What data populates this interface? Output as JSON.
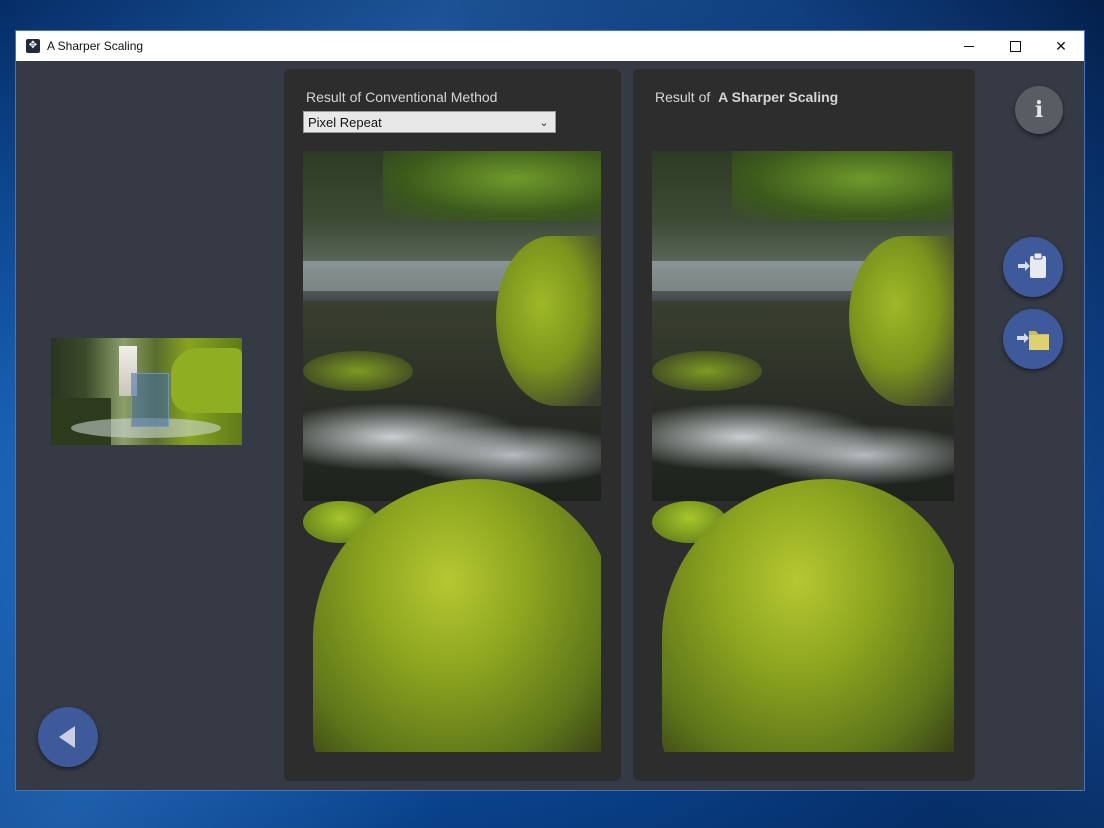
{
  "window": {
    "title": "A Sharper Scaling",
    "app_icon": "app-logo-icon",
    "controls": {
      "minimize": "minimize-icon",
      "maximize": "maximize-icon",
      "close": "close-icon",
      "close_glyph": "✕"
    }
  },
  "left_panel": {
    "title": "Result of Conventional Method",
    "select": {
      "value": "Pixel Repeat",
      "icon": "chevron-down-icon",
      "glyph": "⌄"
    }
  },
  "right_panel": {
    "title_prefix": "Result of",
    "title_brand": "A Sharper Scaling"
  },
  "buttons": {
    "info": {
      "icon": "info-icon",
      "glyph": "i"
    },
    "paste": {
      "icon": "paste-clipboard-icon"
    },
    "open": {
      "icon": "open-folder-icon"
    },
    "back": {
      "icon": "back-arrow-icon"
    }
  },
  "colors": {
    "window_bg": "#353a45",
    "panel_bg": "#2d2d2d",
    "accent_button": "#3f5a9a",
    "info_button": "#595c63",
    "selection_overlay": "#466eaa"
  }
}
